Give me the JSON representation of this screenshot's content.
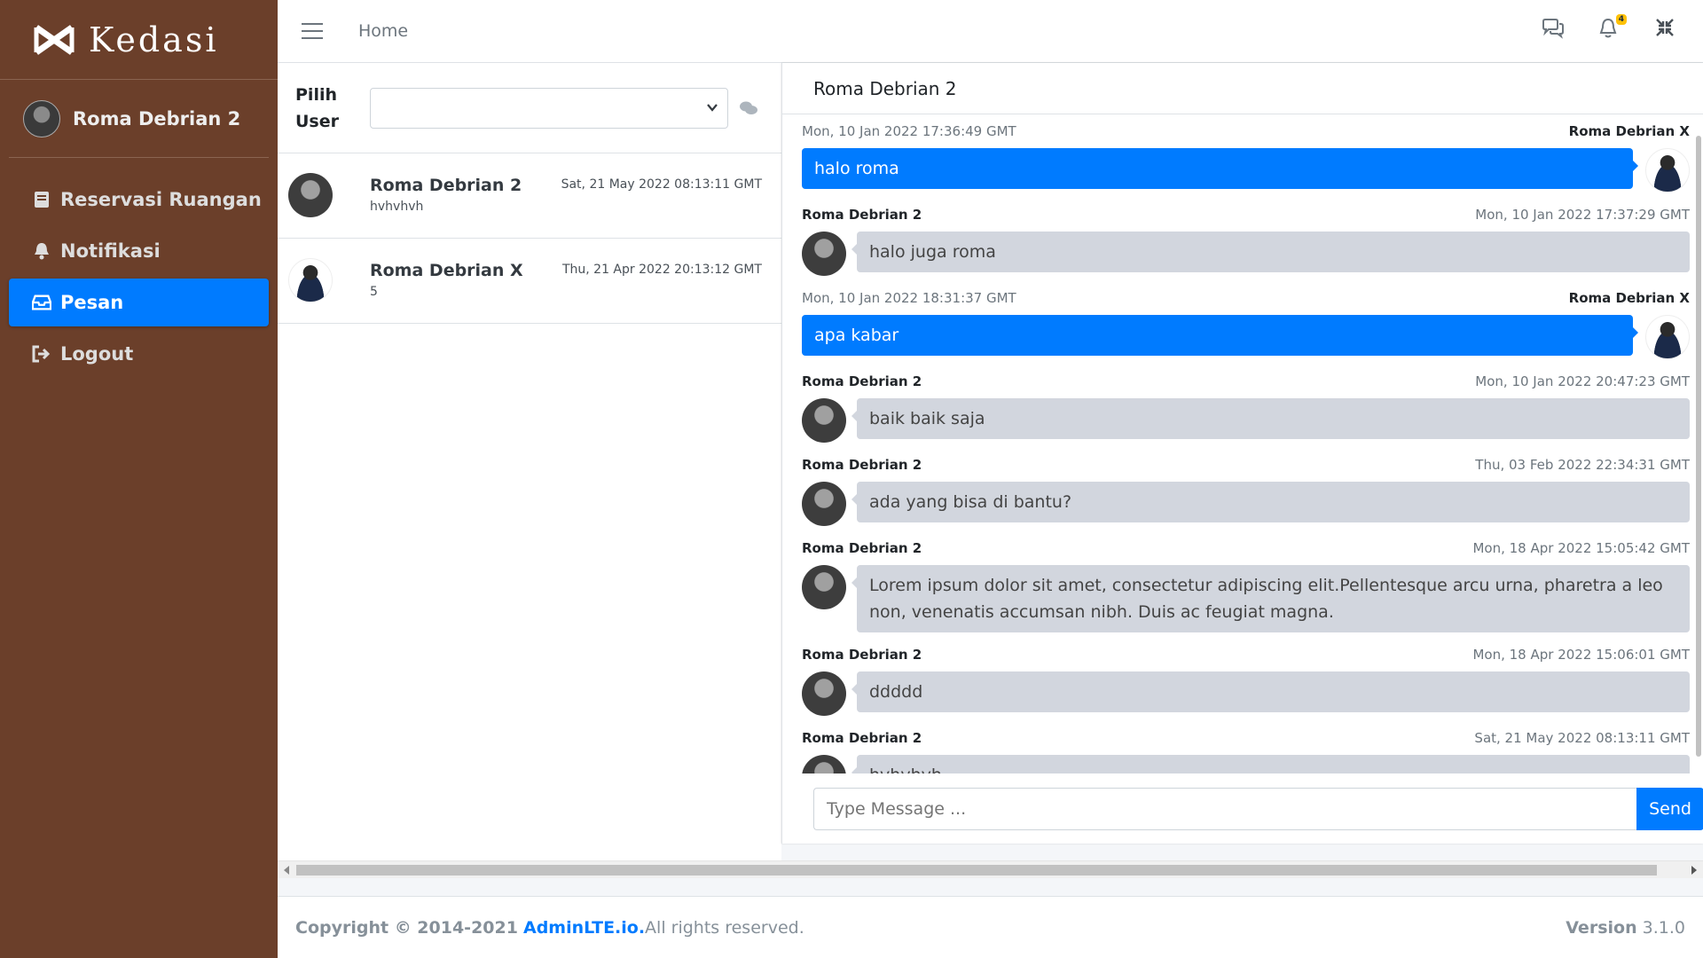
{
  "brand": {
    "name": "Kedasi"
  },
  "sidebar": {
    "user_name": "Roma Debrian 2",
    "items": [
      {
        "label": "Reservasi Ruangan",
        "icon": "book-icon"
      },
      {
        "label": "Notifikasi",
        "icon": "bell-icon"
      },
      {
        "label": "Pesan",
        "icon": "inbox-icon",
        "active": true
      },
      {
        "label": "Logout",
        "icon": "sign-out-icon"
      }
    ]
  },
  "topbar": {
    "home_label": "Home",
    "notification_count": "4",
    "icons": [
      "comments-icon",
      "bell-icon",
      "compress-icon"
    ]
  },
  "user_list": {
    "pick_label_1": "Pilih",
    "pick_label_2": "User",
    "select_value": "",
    "rows": [
      {
        "name": "Roma Debrian 2",
        "last_message": "hvhvhvh",
        "time": "Sat, 21 May 2022 08:13:11 GMT"
      },
      {
        "name": "Roma Debrian X",
        "last_message": "5",
        "time": "Thu, 21 Apr 2022 20:13:12 GMT"
      }
    ]
  },
  "chat": {
    "title": "Roma Debrian 2",
    "messages": [
      {
        "direction": "out",
        "name": "Roma Debrian X",
        "time": "Mon, 10 Jan 2022 17:36:49 GMT",
        "text": "halo roma"
      },
      {
        "direction": "in",
        "name": "Roma Debrian 2",
        "time": "Mon, 10 Jan 2022 17:37:29 GMT",
        "text": "halo juga roma"
      },
      {
        "direction": "out",
        "name": "Roma Debrian X",
        "time": "Mon, 10 Jan 2022 18:31:37 GMT",
        "text": "apa kabar"
      },
      {
        "direction": "in",
        "name": "Roma Debrian 2",
        "time": "Mon, 10 Jan 2022 20:47:23 GMT",
        "text": "baik baik saja"
      },
      {
        "direction": "in",
        "name": "Roma Debrian 2",
        "time": "Thu, 03 Feb 2022 22:34:31 GMT",
        "text": "ada yang bisa di bantu?"
      },
      {
        "direction": "in",
        "name": "Roma Debrian 2",
        "time": "Mon, 18 Apr 2022 15:05:42 GMT",
        "text": "Lorem ipsum dolor sit amet, consectetur adipiscing elit.Pellentesque arcu urna, pharetra a leo non, venenatis accumsan nibh. Duis ac feugiat magna."
      },
      {
        "direction": "in",
        "name": "Roma Debrian 2",
        "time": "Mon, 18 Apr 2022 15:06:01 GMT",
        "text": "ddddd"
      },
      {
        "direction": "in",
        "name": "Roma Debrian 2",
        "time": "Sat, 21 May 2022 08:13:11 GMT",
        "text": "hvhvhvh"
      }
    ],
    "input_placeholder": "Type Message ...",
    "send_label": "Send"
  },
  "footer": {
    "copyright_prefix": "Copyright © 2014-2021",
    "link_text": "AdminLTE.io.",
    "suffix": "All rights reserved.",
    "version_label": "Version",
    "version_value": "3.1.0"
  },
  "colors": {
    "sidebar": "#6b3f2a",
    "accent": "#007bff",
    "bubble_in": "#d2d6de",
    "badge": "#ffc107"
  }
}
